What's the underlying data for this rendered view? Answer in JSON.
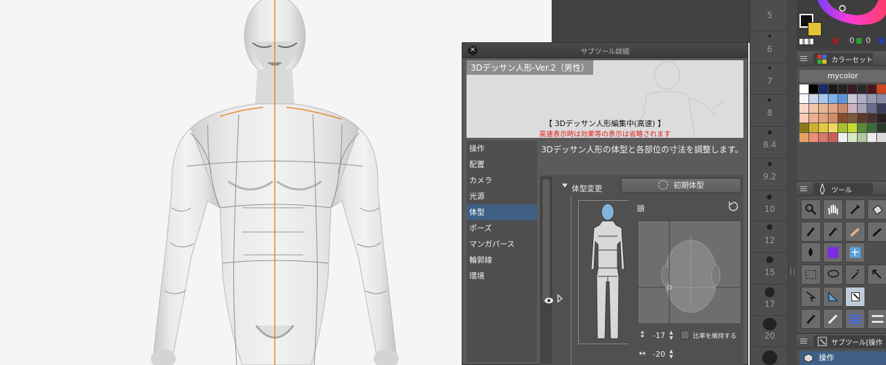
{
  "subtool_panel": {
    "title": "サブツール詳細",
    "preview": {
      "name": "3Dデッサン人形-Ver.2（男性）",
      "message": "【 3Dデッサン人形編集中(高速) 】",
      "warning": "高速表示時は効果等の表示は省略されます"
    },
    "categories": [
      {
        "label": "操作"
      },
      {
        "label": "配置"
      },
      {
        "label": "カメラ"
      },
      {
        "label": "光源"
      },
      {
        "label": "体型",
        "selected": true
      },
      {
        "label": "ポーズ"
      },
      {
        "label": "マンガパース"
      },
      {
        "label": "輪郭線"
      },
      {
        "label": "環境"
      }
    ],
    "description": "3Dデッサン人形の体型と各部位の寸法を調整します。",
    "body_type_label": "体型変更",
    "reset_button": "初期体型",
    "part_label": "頭",
    "height_value": "-17",
    "keep_ratio_label": "比率を維持する",
    "width_value": "-20"
  },
  "brush_sizes": [
    "5",
    "6",
    "7",
    "8",
    "8.4",
    "9.2",
    "10",
    "12",
    "15",
    "17",
    "20"
  ],
  "color_set": {
    "tab_label": "カラーセット",
    "set_name": "mycolor",
    "numbers": [
      "0",
      "0"
    ]
  },
  "tool_palette": {
    "tab_label": "ツール"
  },
  "subtool_palette": {
    "tab_label": "サブツール[操作",
    "item_label": "操作"
  },
  "colors": {
    "accent_selected": "#3f5f85",
    "guide_line": "#e8892e",
    "warning_text": "#e01b1b"
  }
}
